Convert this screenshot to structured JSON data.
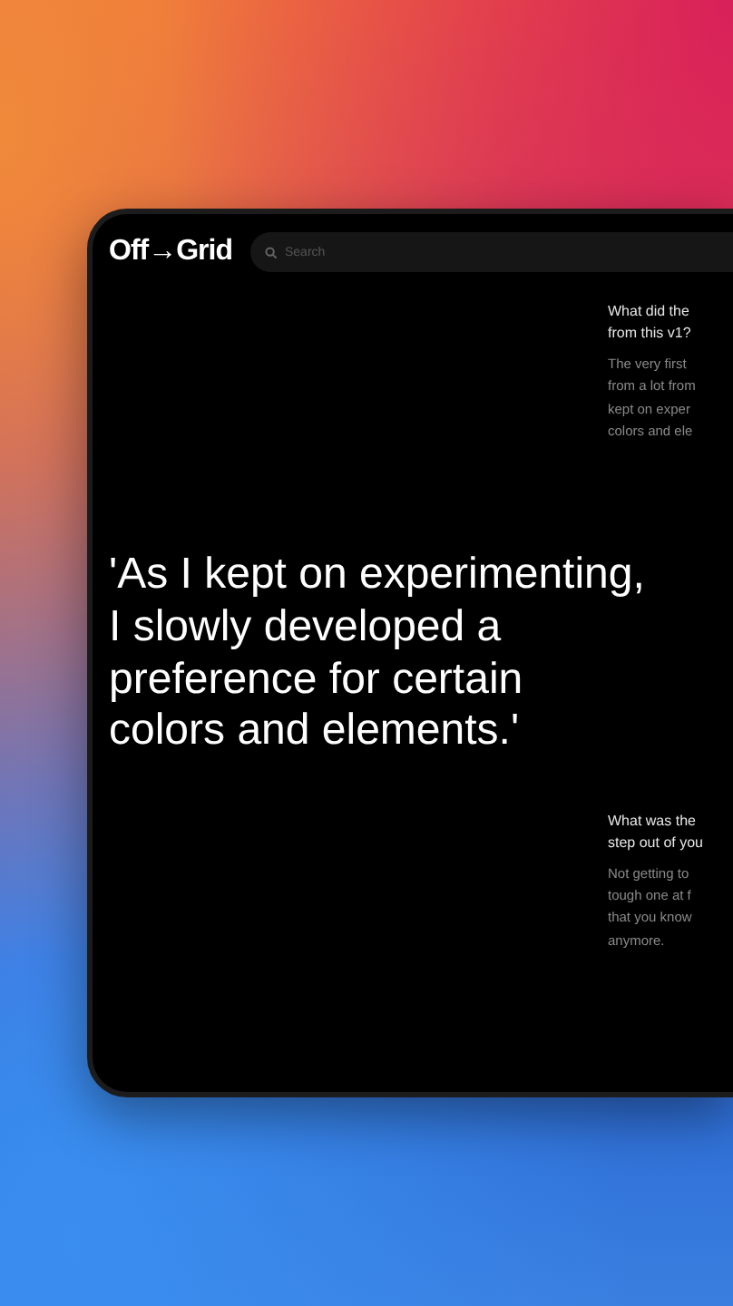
{
  "header": {
    "logo": "Off→Grid",
    "search": {
      "placeholder": "Search"
    }
  },
  "quote": {
    "lines": [
      "'As I kept on experimenting,",
      "I slowly developed a",
      "preference for certain",
      "colors and elements.'"
    ]
  },
  "sidebar": [
    {
      "question": [
        "What did the",
        "from this v1?"
      ],
      "answer": [
        "The very first",
        "from a lot from",
        "kept on exper",
        "colors and ele"
      ]
    },
    {
      "question": [
        "What was the",
        "step out of you"
      ],
      "answer": [
        "Not getting to",
        "tough one at f",
        "that you know",
        "anymore."
      ]
    }
  ]
}
